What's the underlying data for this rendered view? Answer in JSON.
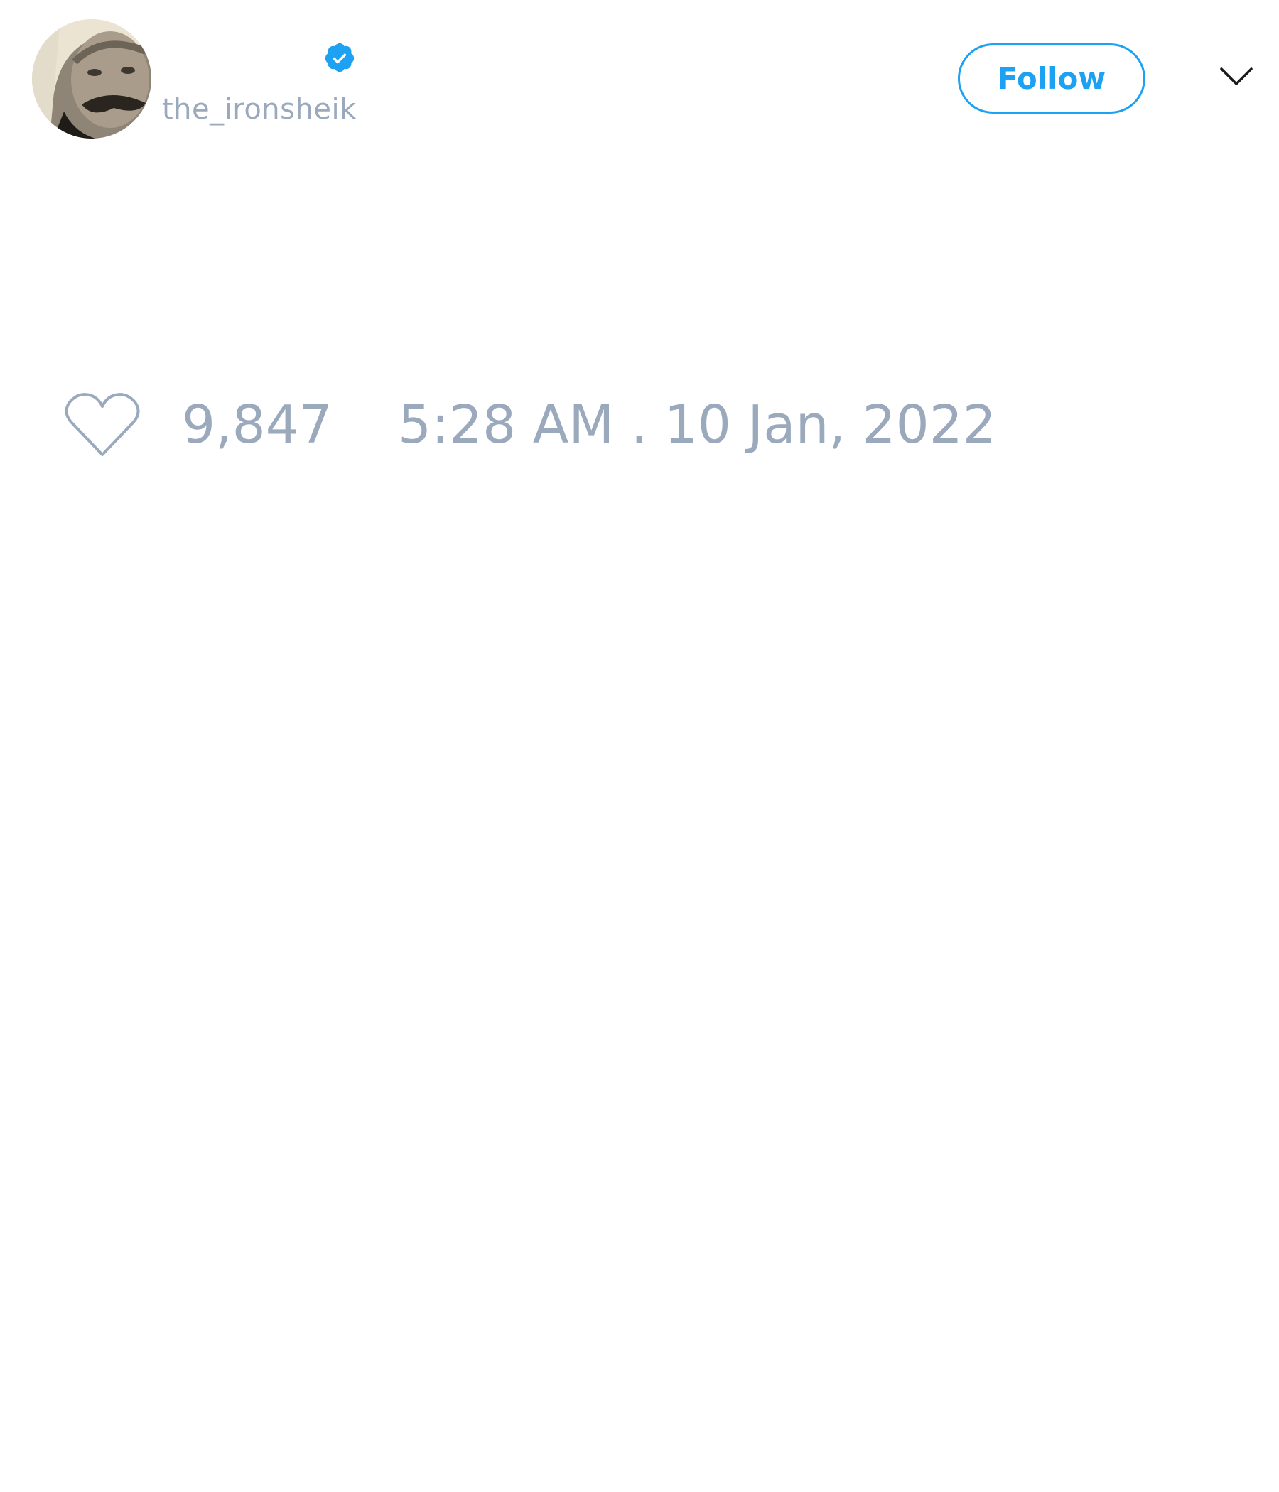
{
  "tweet": {
    "author": {
      "handle": "the_ironsheik",
      "verified": true,
      "avatar_icon": "profile-photo",
      "verified_icon": "verified-badge-icon"
    },
    "follow_label": "Follow",
    "menu_icon": "chevron-down-icon",
    "like_icon": "heart-icon",
    "like_count": "9,847",
    "timestamp": "5:28 AM . 10 Jan, 2022"
  },
  "colors": {
    "accent": "#1da1f2",
    "muted_text": "#9aa9bc",
    "background": "#ffffff"
  }
}
